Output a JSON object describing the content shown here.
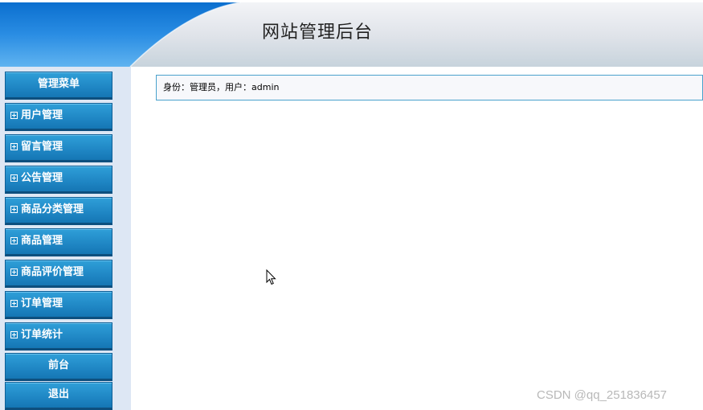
{
  "header": {
    "title": "网站管理后台"
  },
  "sidebar": {
    "heading": "管理菜单",
    "items": [
      {
        "label": "用户管理",
        "icon": "plus-box-icon"
      },
      {
        "label": "留言管理",
        "icon": "plus-box-icon"
      },
      {
        "label": "公告管理",
        "icon": "plus-box-icon"
      },
      {
        "label": "商品分类管理",
        "icon": "plus-box-icon"
      },
      {
        "label": "商品管理",
        "icon": "plus-box-icon"
      },
      {
        "label": "商品评价管理",
        "icon": "plus-box-icon"
      },
      {
        "label": "订单管理",
        "icon": "plus-box-icon"
      },
      {
        "label": "订单统计",
        "icon": "plus-box-icon"
      }
    ],
    "frontend_label": "前台",
    "logout_label": "退出"
  },
  "main": {
    "identity_label": "身份：",
    "role": "管理员",
    "separator": "，",
    "user_label": "用户：",
    "username": "admin"
  },
  "watermark": "CSDN @qq_251836457",
  "colors": {
    "menu_button": "#1f86c4",
    "sidebar_bg": "#dde7f4",
    "header_blue": "#1a7fd6",
    "identity_border": "#4aa2cc"
  }
}
